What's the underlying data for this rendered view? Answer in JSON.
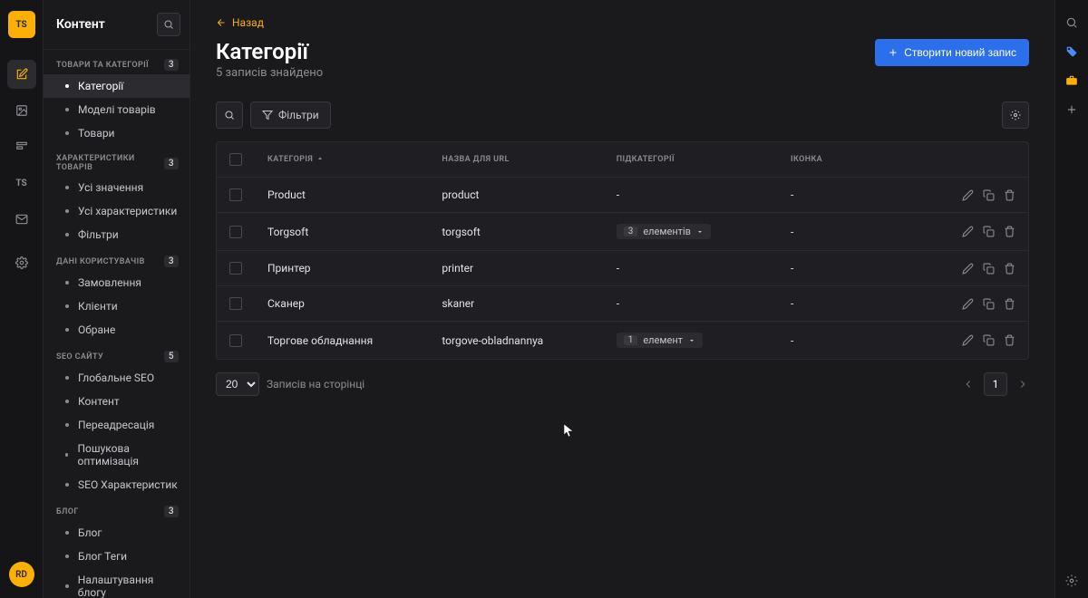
{
  "sidebar": {
    "title": "Контент",
    "sections": [
      {
        "label": "ТОВАРИ ТА КАТЕГОРІЇ",
        "count": "3",
        "items": [
          "Категорії",
          "Моделі товарів",
          "Товари"
        ],
        "active": 0
      },
      {
        "label": "ХАРАКТЕРИСТИКИ ТОВАРІВ",
        "count": "3",
        "items": [
          "Усі значення",
          "Усі характеристики",
          "Фільтри"
        ]
      },
      {
        "label": "ДАНІ КОРИСТУВАЧІВ",
        "count": "3",
        "items": [
          "Замовлення",
          "Клієнти",
          "Обране"
        ]
      },
      {
        "label": "SEO САЙТУ",
        "count": "5",
        "items": [
          "Глобальне SEO",
          "Контент",
          "Переадресація",
          "Пошукова оптимізація",
          "SEO Характеристик"
        ]
      },
      {
        "label": "БЛОГ",
        "count": "3",
        "items": [
          "Блог",
          "Блог Теги",
          "Налаштування блогу"
        ]
      }
    ]
  },
  "avatar_initials": "RD",
  "logo_text": "TS",
  "page": {
    "back_label": "Назад",
    "title": "Категорії",
    "subtitle": "5 записів знайдено",
    "create_label": "Створити новий запис",
    "filter_label": "Фільтри"
  },
  "table": {
    "columns": [
      "КАТЕГОРІЯ",
      "НАЗВА ДЛЯ URL",
      "ПІДКАТЕГОРІЇ",
      "ІКОНКА"
    ],
    "rows": [
      {
        "cat": "Product",
        "url": "product",
        "sub": null,
        "icon": "-"
      },
      {
        "cat": "Torgsoft",
        "url": "torgsoft",
        "sub": {
          "num": "3",
          "word": "елементів"
        },
        "icon": "-"
      },
      {
        "cat": "Принтер",
        "url": "printer",
        "sub": null,
        "icon": "-"
      },
      {
        "cat": "Сканер",
        "url": "skaner",
        "sub": null,
        "icon": "-"
      },
      {
        "cat": "Торгове обладнання",
        "url": "torgove-obladnannya",
        "sub": {
          "num": "1",
          "word": "елемент"
        },
        "icon": "-"
      }
    ]
  },
  "pager": {
    "per_page": "20",
    "per_page_label": "Записів на сторінці",
    "page_num": "1"
  }
}
